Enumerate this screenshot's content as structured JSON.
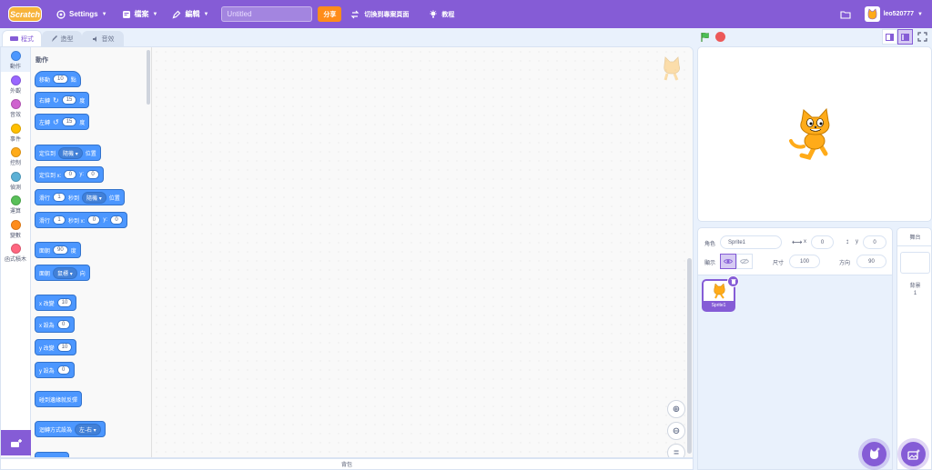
{
  "menubar": {
    "logo": "Scratch",
    "settings_label": "Settings",
    "file_label": "檔案",
    "edit_label": "編輯",
    "project_title_value": "",
    "project_title_placeholder": "Untitled",
    "share_label": "分享",
    "see_project_page_label": "切換到專案頁面",
    "tutorials_label": "教程",
    "username": "leo520777"
  },
  "tabs": {
    "code": "程式",
    "costumes": "造型",
    "sounds": "音效"
  },
  "categories": [
    {
      "label": "動作",
      "color": "#4c97ff"
    },
    {
      "label": "外觀",
      "color": "#9966ff"
    },
    {
      "label": "音效",
      "color": "#cf63cf"
    },
    {
      "label": "事件",
      "color": "#ffbf00"
    },
    {
      "label": "控制",
      "color": "#ffab19"
    },
    {
      "label": "偵測",
      "color": "#5cb1d6"
    },
    {
      "label": "運算",
      "color": "#59c059"
    },
    {
      "label": "變數",
      "color": "#ff8c1a"
    },
    {
      "label": "函式積木",
      "color": "#ff6680"
    }
  ],
  "palette": {
    "title": "動作",
    "blocks": {
      "move": {
        "pre": "移動",
        "val": "10",
        "post": "點"
      },
      "turn_right": {
        "pre": "右轉",
        "val": "15",
        "post": "度"
      },
      "turn_left": {
        "pre": "左轉",
        "val": "15",
        "post": "度"
      },
      "goto": {
        "pre": "定位到",
        "dd": "隨機",
        "post": "位置"
      },
      "goto_xy": {
        "pre": "定位到 x:",
        "x": "0",
        "mid": "y:",
        "y": "0"
      },
      "glide_to": {
        "pre": "滑行",
        "val": "1",
        "mid": "秒到",
        "dd": "隨機",
        "post": "位置"
      },
      "glide_xy": {
        "pre": "滑行",
        "val": "1",
        "mid": "秒到 x:",
        "x": "0",
        "mid2": "y:",
        "y": "0"
      },
      "point_dir": {
        "pre": "面朝",
        "val": "90",
        "post": "度"
      },
      "point_towards": {
        "pre": "面朝",
        "dd": "鼠標",
        "post": "向"
      },
      "change_x": {
        "pre": "x 改變",
        "val": "10"
      },
      "set_x": {
        "pre": "x 設為",
        "val": "0"
      },
      "change_y": {
        "pre": "y 改變",
        "val": "10"
      },
      "set_y": {
        "pre": "y 設為",
        "val": "0"
      },
      "bounce": {
        "label": "碰到邊緣就反彈"
      },
      "rotation_style": {
        "pre": "迴轉方式設為",
        "dd": "左-右"
      }
    }
  },
  "backpack_label": "背包",
  "sprite_info": {
    "sprite_label": "角色",
    "sprite_name": "Sprite1",
    "x_label": "x",
    "x_value": "0",
    "y_label": "y",
    "y_value": "0",
    "show_label": "顯示",
    "size_label": "尺寸",
    "size_value": "100",
    "direction_label": "方向",
    "direction_value": "90"
  },
  "sprite_list": [
    {
      "name": "Sprite1",
      "selected": true
    }
  ],
  "stage_panel": {
    "title": "舞台",
    "backdrops_label": "背景",
    "backdrops_count": "1"
  },
  "colors": {
    "brand": "#855cd6",
    "motion": "#4c97ff",
    "share": "#ff8c1a",
    "stop": "#ec5959",
    "flag": "#4cbf56"
  }
}
